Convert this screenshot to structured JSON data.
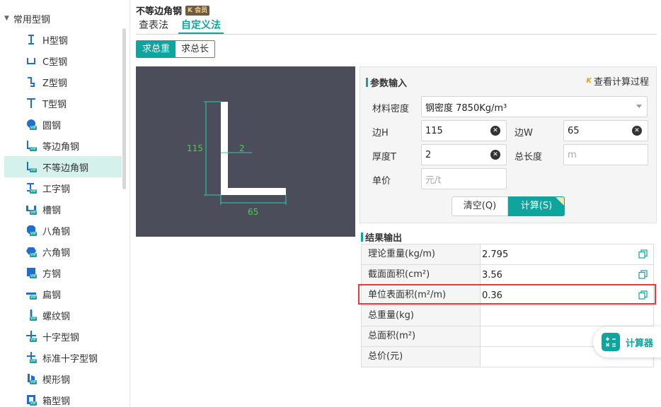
{
  "sidebar": {
    "category": "常用型钢",
    "items": [
      {
        "label": "H型钢",
        "icon": "h-beam-icon",
        "vip": false
      },
      {
        "label": "C型钢",
        "icon": "c-channel-icon",
        "vip": false
      },
      {
        "label": "Z型钢",
        "icon": "z-section-icon",
        "vip": false
      },
      {
        "label": "T型钢",
        "icon": "t-section-icon",
        "vip": false
      },
      {
        "label": "圆钢",
        "icon": "round-bar-icon",
        "vip": true
      },
      {
        "label": "等边角钢",
        "icon": "equal-angle-icon",
        "vip": true
      },
      {
        "label": "不等边角钢",
        "icon": "unequal-angle-icon",
        "vip": true
      },
      {
        "label": "工字钢",
        "icon": "i-beam-icon",
        "vip": true
      },
      {
        "label": "槽钢",
        "icon": "channel-icon",
        "vip": true
      },
      {
        "label": "八角钢",
        "icon": "octagon-bar-icon",
        "vip": true
      },
      {
        "label": "六角钢",
        "icon": "hexagon-bar-icon",
        "vip": true
      },
      {
        "label": "方钢",
        "icon": "square-bar-icon",
        "vip": true
      },
      {
        "label": "扁钢",
        "icon": "flat-bar-icon",
        "vip": true
      },
      {
        "label": "螺纹钢",
        "icon": "rebar-icon",
        "vip": true
      },
      {
        "label": "十字型钢",
        "icon": "cross-section-icon",
        "vip": true
      },
      {
        "label": "标准十字型钢",
        "icon": "standard-cross-icon",
        "vip": true
      },
      {
        "label": "楔形钢",
        "icon": "wedge-icon",
        "vip": true
      },
      {
        "label": "箱型钢",
        "icon": "box-section-icon",
        "vip": true
      }
    ],
    "active_index": 6
  },
  "header": {
    "title": "不等边角钢",
    "vip_badge": "K 会员",
    "tabs": [
      "查表法",
      "自定义法"
    ],
    "active_tab": 1
  },
  "mode": {
    "weight_label": "求总重",
    "length_label": "求总长"
  },
  "drawing": {
    "height_value": "115",
    "thickness_value": "2",
    "width_value": "65",
    "colors": {
      "background": "#4c4d5a",
      "dimension": "#25d3b0",
      "text": "#2ee22e",
      "shape": "#ffffff"
    }
  },
  "params": {
    "section_title": "参数输入",
    "view_process": "查看计算过程",
    "density_label": "材料密度",
    "density_value": "钢密度 7850Kg/m³",
    "h_label": "边H",
    "h_value": "115",
    "w_label": "边W",
    "w_value": "65",
    "t_label": "厚度T",
    "t_value": "2",
    "total_length_label": "总长度",
    "total_length_placeholder": "m",
    "price_label": "单价",
    "price_placeholder": "元/t",
    "clear_button": "清空(Q)",
    "calc_button": "计算(S)"
  },
  "results": {
    "section_title": "结果输出",
    "rows": [
      {
        "label": "理论重量(kg/m)",
        "value": "2.795"
      },
      {
        "label": "截面面积(cm²)",
        "value": "3.56"
      },
      {
        "label": "单位表面积(m²/m)",
        "value": "0.36"
      },
      {
        "label": "总重量(kg)",
        "value": ""
      },
      {
        "label": "总面积(m²)",
        "value": ""
      },
      {
        "label": "总价(元)",
        "value": ""
      }
    ],
    "highlight_index": 2
  },
  "calculator": {
    "label": "计算器"
  },
  "theme": {
    "accent": "#0fa49e",
    "highlight": "#e23c3c"
  }
}
